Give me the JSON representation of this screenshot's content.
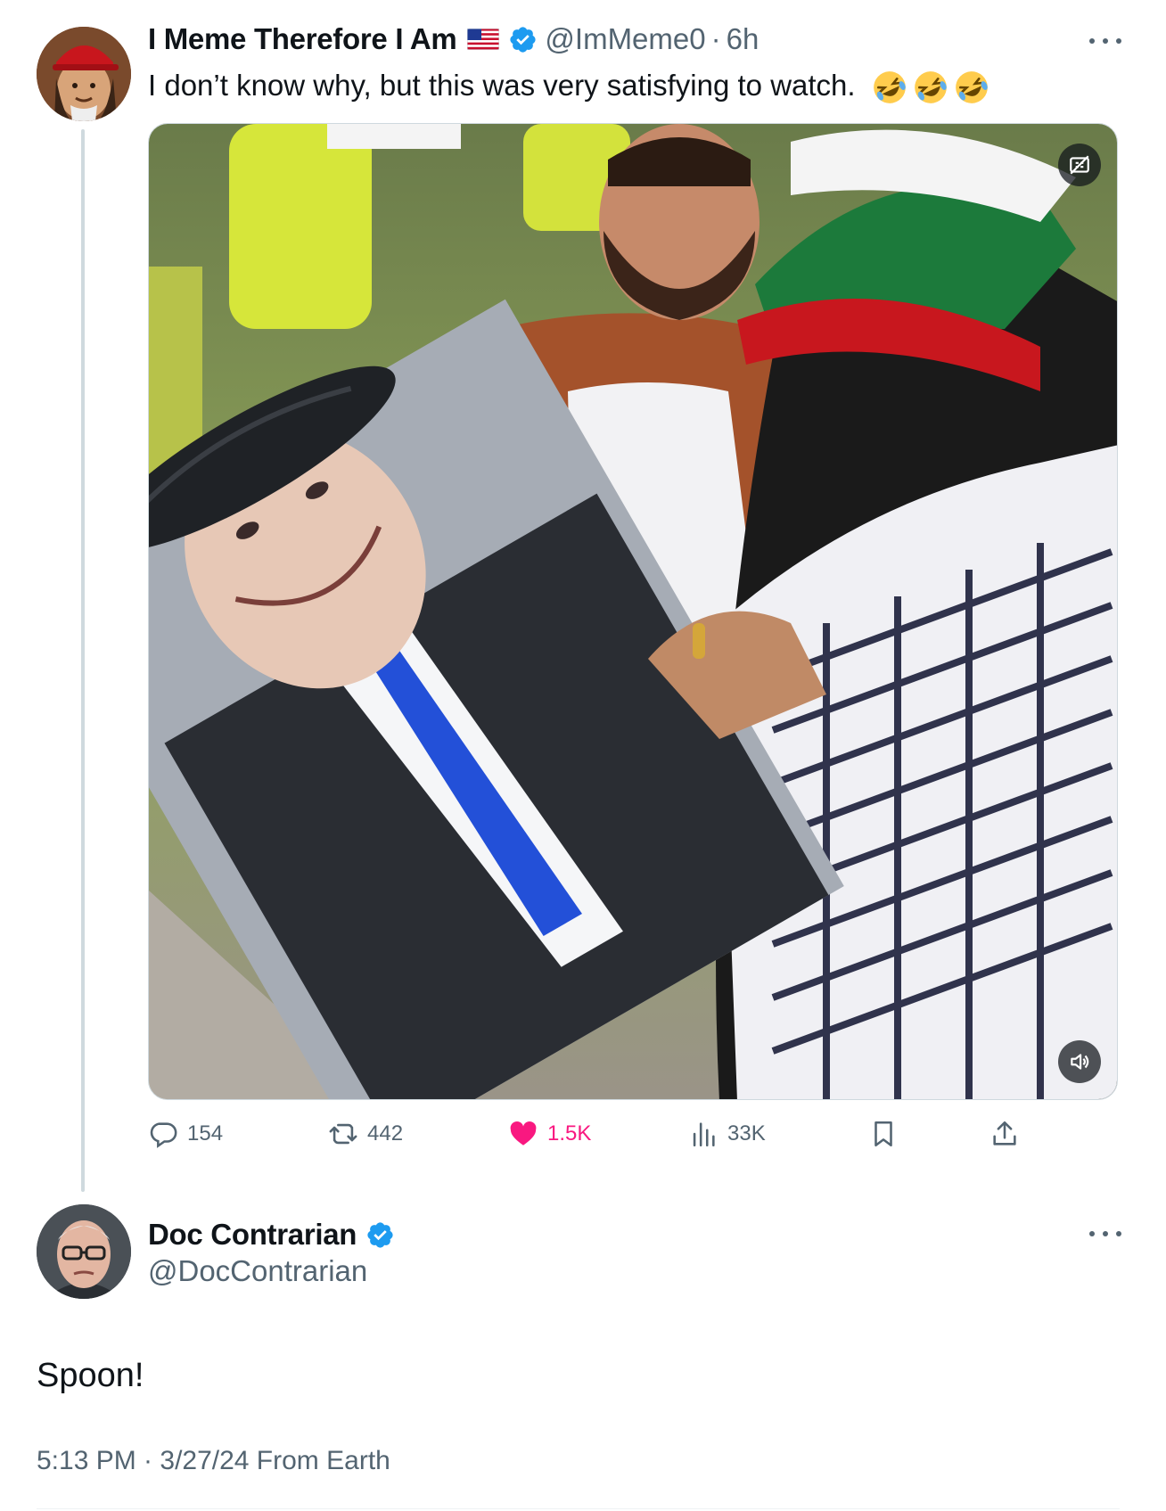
{
  "parent_tweet": {
    "display_name": "I Meme Therefore I Am",
    "handle": "@ImMeme0",
    "separator": "·",
    "time": "6h",
    "text": "I don’t know why, but this was very satisfying to watch.",
    "emoji": [
      "rolling-on-floor-laughing",
      "rolling-on-floor-laughing",
      "rolling-on-floor-laughing"
    ],
    "media": {
      "type": "video",
      "description_icons": [
        "captions-off-icon",
        "sound-icon"
      ]
    },
    "actions": {
      "replies": "154",
      "reposts": "442",
      "likes": "1.5K",
      "views": "33K"
    }
  },
  "main_tweet": {
    "display_name": "Doc Contrarian",
    "handle": "@DocContrarian",
    "text": "Spoon!",
    "timestamp": "5:13 PM · 3/27/24 From Earth"
  },
  "colors": {
    "text_primary": "#0f1419",
    "text_secondary": "#536471",
    "verified": "#1d9bf0",
    "like": "#f91880",
    "thread_line": "#cfd9de"
  }
}
